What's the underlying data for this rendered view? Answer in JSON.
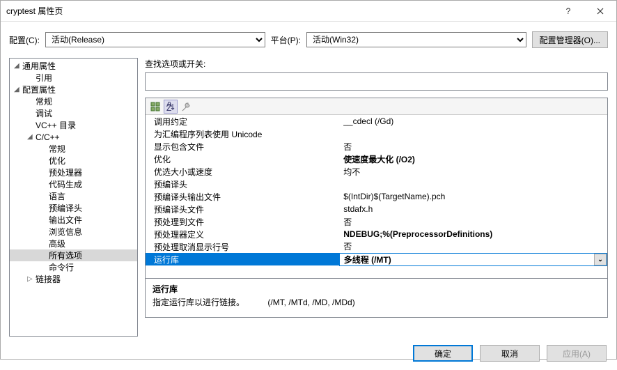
{
  "window": {
    "title": "cryptest 属性页"
  },
  "top": {
    "config_label": "配置(C):",
    "config_value": "活动(Release)",
    "platform_label": "平台(P):",
    "platform_value": "活动(Win32)",
    "manager_btn": "配置管理器(O)..."
  },
  "tree": [
    {
      "label": "通用属性",
      "level": 0,
      "expand": true
    },
    {
      "label": "引用",
      "level": 1
    },
    {
      "label": "配置属性",
      "level": 0,
      "expand": true
    },
    {
      "label": "常规",
      "level": 1
    },
    {
      "label": "调试",
      "level": 1
    },
    {
      "label": "VC++ 目录",
      "level": 1
    },
    {
      "label": "C/C++",
      "level": 1,
      "expand": true
    },
    {
      "label": "常规",
      "level": 2
    },
    {
      "label": "优化",
      "level": 2
    },
    {
      "label": "预处理器",
      "level": 2
    },
    {
      "label": "代码生成",
      "level": 2
    },
    {
      "label": "语言",
      "level": 2
    },
    {
      "label": "预编译头",
      "level": 2
    },
    {
      "label": "输出文件",
      "level": 2
    },
    {
      "label": "浏览信息",
      "level": 2
    },
    {
      "label": "高级",
      "level": 2
    },
    {
      "label": "所有选项",
      "level": 2,
      "selected": true
    },
    {
      "label": "命令行",
      "level": 2
    },
    {
      "label": "链接器",
      "level": 1,
      "collapsed": true
    }
  ],
  "search": {
    "label": "查找选项或开关:",
    "value": ""
  },
  "grid": [
    {
      "k": "调用约定",
      "v": "__cdecl (/Gd)"
    },
    {
      "k": "为汇编程序列表使用 Unicode",
      "v": ""
    },
    {
      "k": "显示包含文件",
      "v": "否"
    },
    {
      "k": "优化",
      "v": "使速度最大化 (/O2)",
      "bold": true
    },
    {
      "k": "优选大小或速度",
      "v": "均不"
    },
    {
      "k": "预编译头",
      "v": ""
    },
    {
      "k": "预编译头输出文件",
      "v": "$(IntDir)$(TargetName).pch"
    },
    {
      "k": "预编译头文件",
      "v": "stdafx.h"
    },
    {
      "k": "预处理到文件",
      "v": "否"
    },
    {
      "k": "预处理器定义",
      "v": "NDEBUG;%(PreprocessorDefinitions)",
      "bold": true
    },
    {
      "k": "预处理取消显示行号",
      "v": "否"
    },
    {
      "k": "运行库",
      "v": "多线程 (/MT)",
      "selected": true,
      "bold": true
    }
  ],
  "desc": {
    "title": "运行库",
    "text_a": "指定运行库以进行链接。",
    "text_b": "(/MT, /MTd, /MD, /MDd)"
  },
  "buttons": {
    "ok": "确定",
    "cancel": "取消",
    "apply": "应用(A)"
  }
}
